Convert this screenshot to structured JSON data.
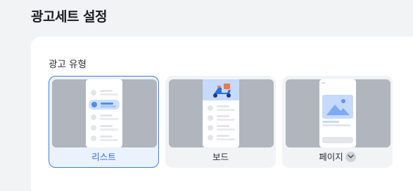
{
  "header": {
    "title": "광고세트 설정"
  },
  "section": {
    "label": "광고 유형"
  },
  "ad_types": [
    {
      "label": "리스트",
      "selected": true
    },
    {
      "label": "보드",
      "selected": false
    },
    {
      "label": "페이지",
      "selected": false
    }
  ],
  "icons": {
    "page_expand": "chevron-down-icon",
    "board_illustration": "scooter-icon"
  },
  "colors": {
    "accent": "#3d7de6",
    "selected_bg": "#eaf2fd",
    "card_bg": "#f2f3f5",
    "preview_bg": "#b0b5be"
  }
}
